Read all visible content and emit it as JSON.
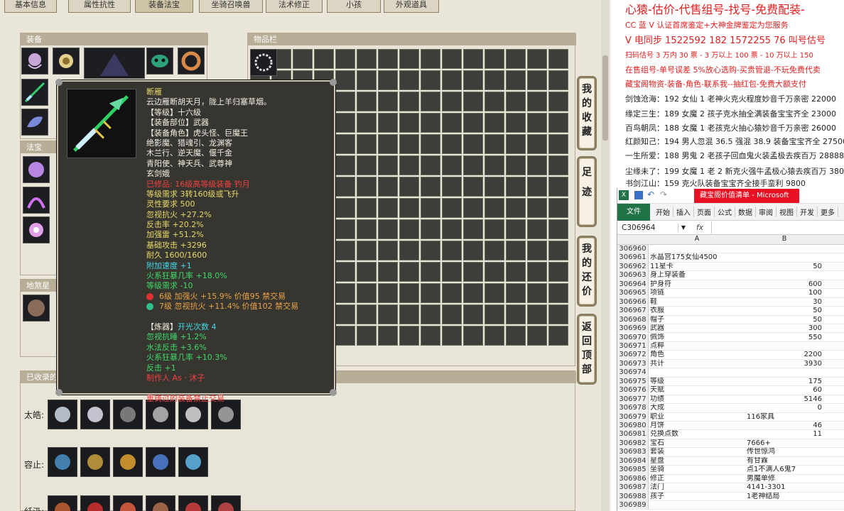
{
  "tabs": [
    "基本信息",
    "属性抗性",
    "装备法宝",
    "坐骑召唤兽",
    "法术修正",
    "小孩",
    "外观道具"
  ],
  "active_tab": 2,
  "panels": {
    "equipment": "装备",
    "treasure": "法宝",
    "star": "地煞星",
    "collection": "已收录的",
    "inventory": "物品栏"
  },
  "side_buttons": [
    "我的收藏",
    "足迹",
    "我的还价",
    "返回顶部"
  ],
  "collection_rows": [
    "太皓:",
    "容止:",
    "纤汲:"
  ],
  "tooltip": {
    "lines": [
      {
        "t": "断雁",
        "c": "y"
      },
      {
        "t": "云边雁断胡天月，陇上羊归塞草烟。",
        "c": "w"
      },
      {
        "t": "【等级】十六级",
        "c": "w"
      },
      {
        "t": "【装备部位】武器",
        "c": "w"
      },
      {
        "t": "【装备角色】虎头怪、巨魔王",
        "c": "w"
      },
      {
        "t": "绝影魔、猎魂引、龙渊客",
        "c": "w"
      },
      {
        "t": "木兰行、逆天魔、偃千金",
        "c": "w"
      },
      {
        "t": "青阳使、神天兵、武尊神",
        "c": "w"
      },
      {
        "t": "玄剑娥",
        "c": "w"
      },
      {
        "t": "高等级装备 钓月",
        "c": "r",
        "pre": "已修品: 16级"
      },
      {
        "t": "等级需求 3转160级或飞升",
        "c": "y"
      },
      {
        "t": "灵性要求 500",
        "c": "y"
      },
      {
        "t": "忽视抗火 +27.2%",
        "c": "y"
      },
      {
        "t": "反击率 +20.2%",
        "c": "y"
      },
      {
        "t": "加强雷 +51.2%",
        "c": "y"
      },
      {
        "t": "基础攻击 +3296",
        "c": "y"
      },
      {
        "t": "耐久 1600/1600",
        "c": "y"
      },
      {
        "t": "附加速度 +1",
        "c": "c"
      },
      {
        "t": "火系狂暴几率 +18.0%",
        "c": "g"
      },
      {
        "t": "等级需求 -10",
        "c": "g"
      },
      {
        "t": "6级 加强火 +15.9% 价值95 禁交易",
        "c": "o",
        "gem": "#e03030"
      },
      {
        "t": "7级 忽视抗火 +11.4% 价值102 禁交易",
        "c": "o",
        "gem": "#2fbf8a"
      },
      {
        "t": "",
        "c": "w"
      },
      {
        "t": "【炼器】开光次数 4",
        "c": "c",
        "pre_w": "【炼器】",
        "rest": "开光次数 4"
      },
      {
        "t": "忽视抗睡 +1.2%",
        "c": "g"
      },
      {
        "t": "水法反击 +3.6%",
        "c": "g"
      },
      {
        "t": "火系狂暴几率 +10.3%",
        "c": "g"
      },
      {
        "t": "反击 +1",
        "c": "g"
      },
      {
        "t": "制作人 As · 沐子",
        "c": "r"
      },
      {
        "t": "",
        "c": "w"
      },
      {
        "t": "重铸过的装备禁止交易",
        "c": "r"
      }
    ]
  },
  "ads": [
    {
      "t": "心猿-估价-代售组号-找号-免费配装-",
      "color": "#e02020",
      "size": 16
    },
    {
      "t": "CC 蓝 V 认证首席鉴定+大神金牌鉴定为您服务",
      "color": "#e02020",
      "size": 11
    },
    {
      "t": "V 电同步 1522592 182 1572255 76 叫号估号",
      "color": "#e02020",
      "size": 13
    },
    {
      "t": "扫码估号 3 万内 30 票 - 3 万以上 100 票 - 10 万以上 150",
      "color": "#e02020",
      "size": 10
    },
    {
      "t": "在售组号-单号误差 5%放心选购-买贵管退-不玩免费代卖",
      "color": "#e02020",
      "size": 11
    },
    {
      "t": "藏宝阁物资-装备-角色-联系我--抽红包-免费大额支付",
      "color": "#e02020",
      "size": 11
    },
    {
      "t": "剑蚀沧海：192 女仙 1 老神火克火程度妙音千万亲密 22000",
      "color": "#222",
      "size": 11
    },
    {
      "t": "缘定三生：189 女魔 2 孩子克水抽全满装备宝宝齐全 23000",
      "color": "#222",
      "size": 11
    },
    {
      "t": "百鸟朝凤：188 女魔 1 老孩克火抽心猿妙音千万亲密 26000",
      "color": "#222",
      "size": 11
    },
    {
      "t": "红颜知己：194 男人忽混 36.5 强混 38.9 装备宝宝齐全 27500",
      "color": "#222",
      "size": 11
    },
    {
      "t": "一生所爱：188 男鬼 2 老孩子回血鬼火装孟极去疾百万 28888",
      "color": "#222",
      "size": 11
    },
    {
      "t": "尘缘未了：199 女魔 1 老 2 新克火强牛孟极心猿去疾百万 380",
      "color": "#222",
      "size": 11
    },
    {
      "t": "书剑江山：159 克火队装备宝宝齐全接手蛮利 9800",
      "color": "#222",
      "size": 11
    }
  ],
  "excel": {
    "title": "藏宝阁价值清单 - Microsoft",
    "file_label": "文件",
    "ribbon": [
      "开始",
      "插入",
      "页面",
      "公式",
      "数据",
      "审阅",
      "视图",
      "开发",
      "更多"
    ],
    "name_box": "C306964",
    "fx": "fx",
    "col_a": "A",
    "col_b": "B",
    "rows": [
      {
        "n": "306960",
        "a": "",
        "b": ""
      },
      {
        "n": "306961",
        "a": "水晶宫175女仙4500",
        "b": ""
      },
      {
        "n": "306962",
        "a": "11星卡",
        "b": "50"
      },
      {
        "n": "306963",
        "a": "身上穿装备",
        "b": ""
      },
      {
        "n": "306964",
        "a": "护身符",
        "b": "600"
      },
      {
        "n": "306965",
        "a": "项链",
        "b": "100"
      },
      {
        "n": "306966",
        "a": "鞋",
        "b": "30"
      },
      {
        "n": "306967",
        "a": "衣服",
        "b": "50"
      },
      {
        "n": "306968",
        "a": "帽子",
        "b": "50"
      },
      {
        "n": "306969",
        "a": "武器",
        "b": "300"
      },
      {
        "n": "306970",
        "a": "佩饰",
        "b": "550"
      },
      {
        "n": "306971",
        "a": "点粹",
        "b": ""
      },
      {
        "n": "306972",
        "a": "角色",
        "b": "2200"
      },
      {
        "n": "306973",
        "a": "共计",
        "b": "3930"
      },
      {
        "n": "306974",
        "a": "",
        "b": ""
      },
      {
        "n": "306975",
        "a": "等级",
        "b": "175"
      },
      {
        "n": "306976",
        "a": "天赋",
        "b": "60"
      },
      {
        "n": "306977",
        "a": "功绩",
        "b": "5146"
      },
      {
        "n": "306978",
        "a": "大成",
        "b": "0"
      },
      {
        "n": "306979",
        "a": "职业",
        "b": "116家具",
        "bt": true
      },
      {
        "n": "306980",
        "a": "月饼",
        "b": "46"
      },
      {
        "n": "306981",
        "a": "兑换点数",
        "b": "11"
      },
      {
        "n": "306982",
        "a": "宝石",
        "b": "7666+",
        "bt": true
      },
      {
        "n": "306983",
        "a": "套装",
        "b": "传世惊鸿",
        "bt": true
      },
      {
        "n": "306984",
        "a": "星盘",
        "b": "有甘霖",
        "bt": true
      },
      {
        "n": "306985",
        "a": "坐骑",
        "b": "点1不满人6鬼7",
        "bt": true
      },
      {
        "n": "306986",
        "a": "修正",
        "b": "男魔单修",
        "bt": true
      },
      {
        "n": "306987",
        "a": "法门",
        "b": "4141-3301",
        "bt": true
      },
      {
        "n": "306988",
        "a": "孩子",
        "b": "1老神结局",
        "bt": true
      },
      {
        "n": "306989",
        "a": "",
        "b": ""
      }
    ]
  }
}
